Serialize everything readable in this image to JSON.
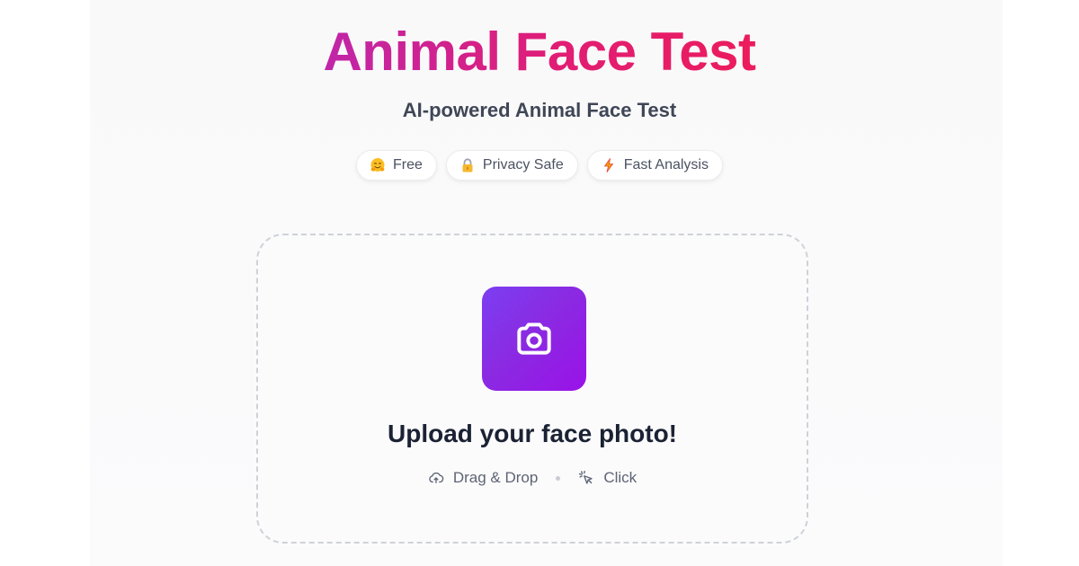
{
  "header": {
    "title": "Animal Face Test",
    "subtitle": "AI-powered Animal Face Test"
  },
  "badges": [
    {
      "label": "Free",
      "icon": "hugging-face-emoji"
    },
    {
      "label": "Privacy Safe",
      "icon": "lock-emoji"
    },
    {
      "label": "Fast Analysis",
      "icon": "lightning-emoji"
    }
  ],
  "upload": {
    "icon": "camera-icon",
    "title": "Upload your face photo!",
    "hint_drag": "Drag & Drop",
    "hint_click": "Click"
  },
  "colors": {
    "title_gradient_start": "#c026a8",
    "title_gradient_end": "#ec1c5c",
    "camera_tile_start": "#7b3ff2",
    "camera_tile_end": "#9a12e8"
  }
}
